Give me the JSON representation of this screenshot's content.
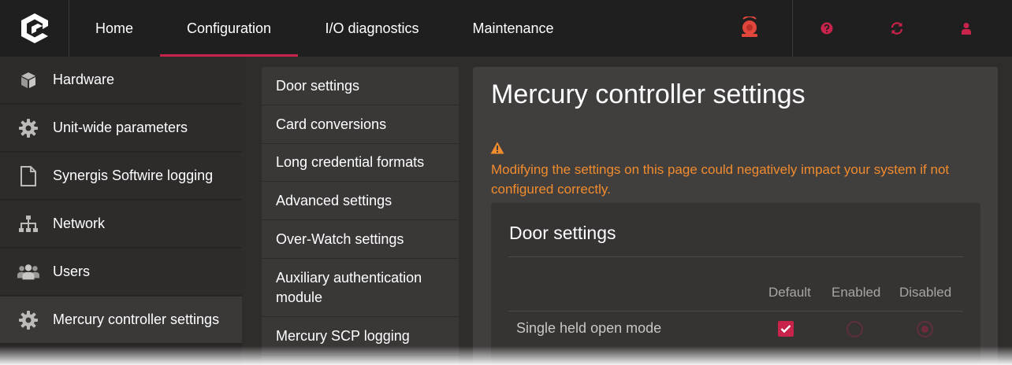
{
  "topbar": {
    "logo_icon": "genetec-logo-icon",
    "nav": [
      {
        "label": "Home"
      },
      {
        "label": "Configuration",
        "active": true
      },
      {
        "label": "I/O diagnostics"
      },
      {
        "label": "Maintenance"
      }
    ],
    "icons": [
      "alarm-bell-icon",
      "help-icon",
      "refresh-icon",
      "user-icon"
    ],
    "accent": "#c8234a",
    "alarm_color": "#e0463c"
  },
  "sidebar": {
    "items": [
      {
        "label": "Hardware",
        "icon": "cube-icon"
      },
      {
        "label": "Unit-wide parameters",
        "icon": "gear-icon"
      },
      {
        "label": "Synergis Softwire logging",
        "icon": "document-icon"
      },
      {
        "label": "Network",
        "icon": "network-icon"
      },
      {
        "label": "Users",
        "icon": "users-icon"
      },
      {
        "label": "Mercury controller settings",
        "icon": "gear-icon",
        "selected": true
      }
    ]
  },
  "submenu": {
    "items": [
      {
        "label": "Door settings"
      },
      {
        "label": "Card conversions"
      },
      {
        "label": "Long credential formats"
      },
      {
        "label": "Advanced settings"
      },
      {
        "label": "Over-Watch settings"
      },
      {
        "label": "Auxiliary authentication module"
      },
      {
        "label": "Mercury SCP logging"
      }
    ]
  },
  "main": {
    "title": "Mercury controller settings",
    "warning_icon": "warning-icon",
    "warning_text": "Modifying the settings on this page could negatively impact your system if not configured correctly.",
    "warning_color": "#f08c2e",
    "card": {
      "title": "Door settings",
      "columns": [
        "Default",
        "Enabled",
        "Disabled"
      ],
      "rows": [
        {
          "label": "Single held open mode",
          "default": true,
          "value": "Disabled"
        }
      ]
    }
  }
}
